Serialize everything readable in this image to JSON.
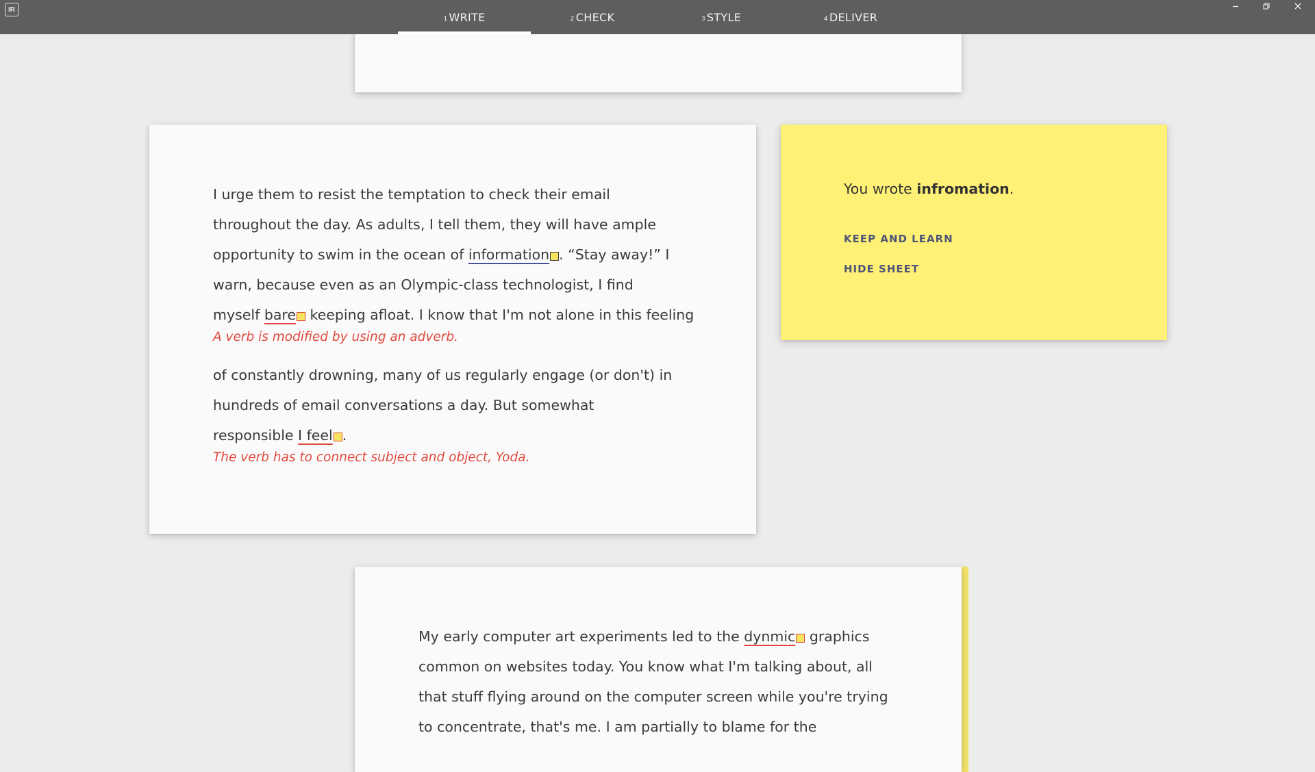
{
  "app": {
    "icon_label": "IR"
  },
  "tabs": [
    {
      "num": "1",
      "label": "WRITE",
      "active": true
    },
    {
      "num": "2",
      "label": "CHECK",
      "active": false
    },
    {
      "num": "3",
      "label": "STYLE",
      "active": false
    },
    {
      "num": "4",
      "label": "DELIVER",
      "active": false
    }
  ],
  "window_controls": {
    "minimize": "minimize-icon",
    "restore": "restore-icon",
    "close": "close-icon"
  },
  "main_sheet": {
    "line1": "I urge them to resist the temptation to check their email",
    "line2": "throughout the day. As adults, I tell them, they will have ample",
    "line3_pre": "opportunity to swim in the ocean of ",
    "line3_err": "information",
    "line3_post": ". “Stay away!” I",
    "line4": "warn, because even as an Olympic-class technologist, I find",
    "line5_pre": "myself ",
    "line5_err": "bare",
    "line5_post": " keeping afloat. I know that I'm not alone in this feeling",
    "note1": "A verb is modified by using an adverb.",
    "line6": "of constantly drowning, many of us regularly engage (or don't) in",
    "line7": "hundreds of email conversations a day. But somewhat",
    "line8_pre": "responsible ",
    "line8_err": "I feel",
    "line8_post": ".",
    "note2": "The verb has to connect subject and object, Yoda."
  },
  "spell_panel": {
    "prefix": "You wrote ",
    "word": "infromation",
    "suffix": ".",
    "keep_button": "KEEP AND LEARN",
    "hide_button": "HIDE SHEET",
    "color": "#fff176"
  },
  "bottom_sheet": {
    "line1_pre": "My early computer art experiments led to the ",
    "line1_err": "dynmic",
    "line1_post": " graphics",
    "line2": "common on websites today. You know what I'm talking about, all",
    "line3": "that stuff flying around on the computer screen while you're trying",
    "line4": "to concentrate, that's me. I am partially to blame for the"
  },
  "colors": {
    "topbar": "#5e5e5e",
    "error_red": "#e04a3f",
    "error_blue": "#4a4ea0",
    "highlight_yellow": "#f7e45e"
  }
}
